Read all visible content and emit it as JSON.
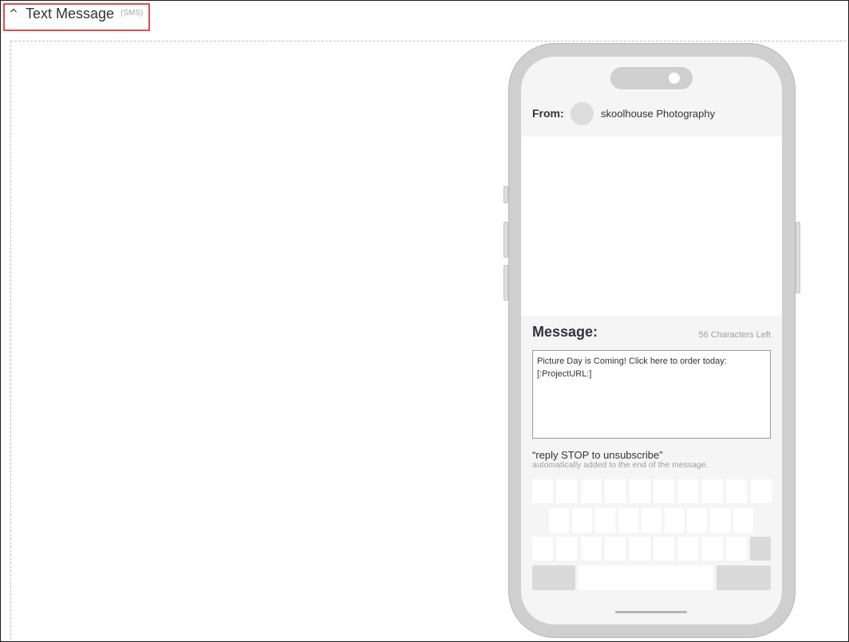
{
  "section": {
    "title": "Text Message",
    "tag": "(SMS)"
  },
  "preview": {
    "from_label": "From:",
    "sender_name": "skoolhouse Photography",
    "message_heading": "Message:",
    "chars_left": "56 Characters Left",
    "message_text": "Picture Day is Coming! Click here to order today:\n[:ProjectURL:]",
    "stop_text": "“reply STOP to unsubscribe”",
    "stop_note": "automatically added to the end of the message."
  },
  "keyboard": {
    "row1_keys": 10,
    "row2_keys": 9,
    "row3_keys": 9
  },
  "colors": {
    "highlight_border": "#e24b4b",
    "phone_frame": "#cfcfcf"
  }
}
